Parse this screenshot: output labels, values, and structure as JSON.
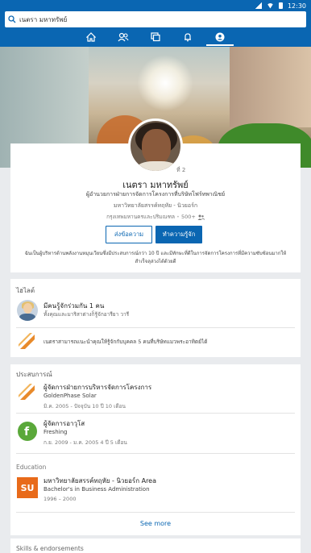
{
  "status_bar": {
    "time": "12:30"
  },
  "search": {
    "value": "เนตรา มหาทรัพย์"
  },
  "nav": {
    "tabs": [
      {
        "name": "home"
      },
      {
        "name": "my-network"
      },
      {
        "name": "messaging"
      },
      {
        "name": "notifications"
      },
      {
        "name": "me",
        "active": true
      }
    ]
  },
  "profile": {
    "degree": "ที่ 2",
    "name": "เนตรา มหาทรัพย์",
    "headline": "ผู้อำนวยการฝ่ายการจัดการโครงการที่บริษัทโฟร์ทพาณิชย์",
    "school": "มหาวิทยาลัยสรรค์ทฤหัย - นิวยอร์ก",
    "location": "กรุงเทพมหานครและปริมณฑล",
    "connections": "500+",
    "message_button": "ส่งข้อความ",
    "connect_button": "ทำความรู้จัก",
    "summary": "ฉันเป็นผู้บริหารด้านพลังงานหมุนเวียนซึ่งมีประสบการณ์กว่า 10 ปี และมีทักษะที่ดีในการจัดการโครงการที่มีความซับซ้อนมากให้สำเร็จลุล่วงได้ด้วยดี"
  },
  "highlights": {
    "title": "ไฮไลต์",
    "mutual": {
      "main": "มีคนรู้จักร่วมกัน 1 คน",
      "sub": "ทั้งคุณและมาริสาต่างก็รู้จักอารียา วารี"
    },
    "intro": {
      "text": "เนตราสามารถแนะนำคุณให้รู้จักกับบุคคล 5 คนที่บริษัทแมวพระอาทิตย์ได้"
    },
    "colors": {
      "accent": "#e88a2a"
    }
  },
  "experience": {
    "title": "ประสบการณ์",
    "items": [
      {
        "title": "ผู้จัดการฝ่ายการบริหารจัดการโครงการ",
        "company": "GoldenPhase Solar",
        "dates": "มิ.ค. 2005 - ปัจจุบัน  10 ปี 10 เดือน",
        "logo": "goldenphase-logo"
      },
      {
        "title": "ผู้จัดการอาวุโส",
        "company": "Freshing",
        "dates": "ก.ย. 2009 - ม.ค. 2005  4 ปี 5 เดือน",
        "logo": "freshing-logo"
      }
    ],
    "education_title": "Education",
    "education": {
      "school": "มหาวิทยาลัยสรรค์ทฤหัย - นิวยอร์ก Area",
      "degree": "Bachelor's in Business Administration",
      "dates": "1996 – 2000",
      "logo_text": "SU"
    },
    "see_more": "See more"
  },
  "skills": {
    "title": "Skills & endorsements"
  }
}
